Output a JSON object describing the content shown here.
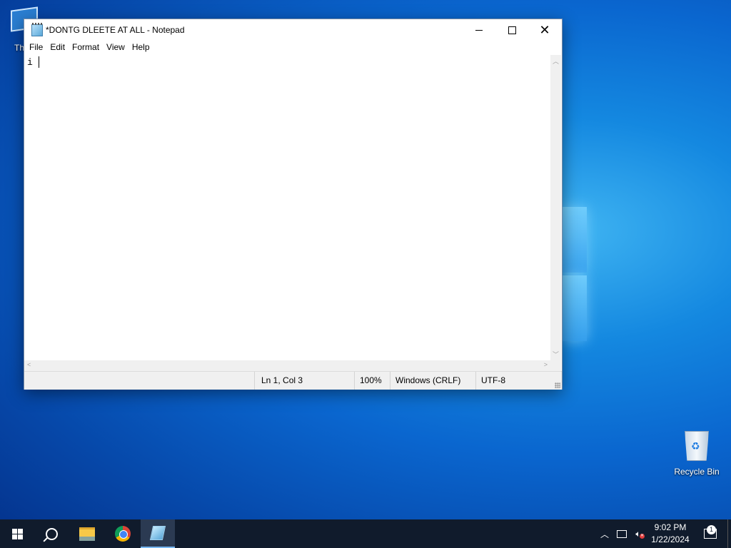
{
  "desktop": {
    "icons": [
      {
        "label": "Th"
      },
      {
        "label": "Recycle Bin"
      }
    ]
  },
  "notepad": {
    "title": "*DONTG DLEETE AT ALL - Notepad",
    "menu": [
      "File",
      "Edit",
      "Format",
      "View",
      "Help"
    ],
    "content": "i",
    "status": {
      "position": "Ln 1, Col 3",
      "zoom": "100%",
      "line_ending": "Windows (CRLF)",
      "encoding": "UTF-8"
    }
  },
  "taskbar": {
    "apps": [
      "start-icon",
      "search-icon",
      "file-explorer-icon",
      "chrome-icon",
      "notepad-icon"
    ],
    "time": "9:02 PM",
    "date": "1/22/2024",
    "notification_count": "1"
  },
  "colors": {
    "taskbar": "#101b2c",
    "accent": "#77b7f2"
  }
}
